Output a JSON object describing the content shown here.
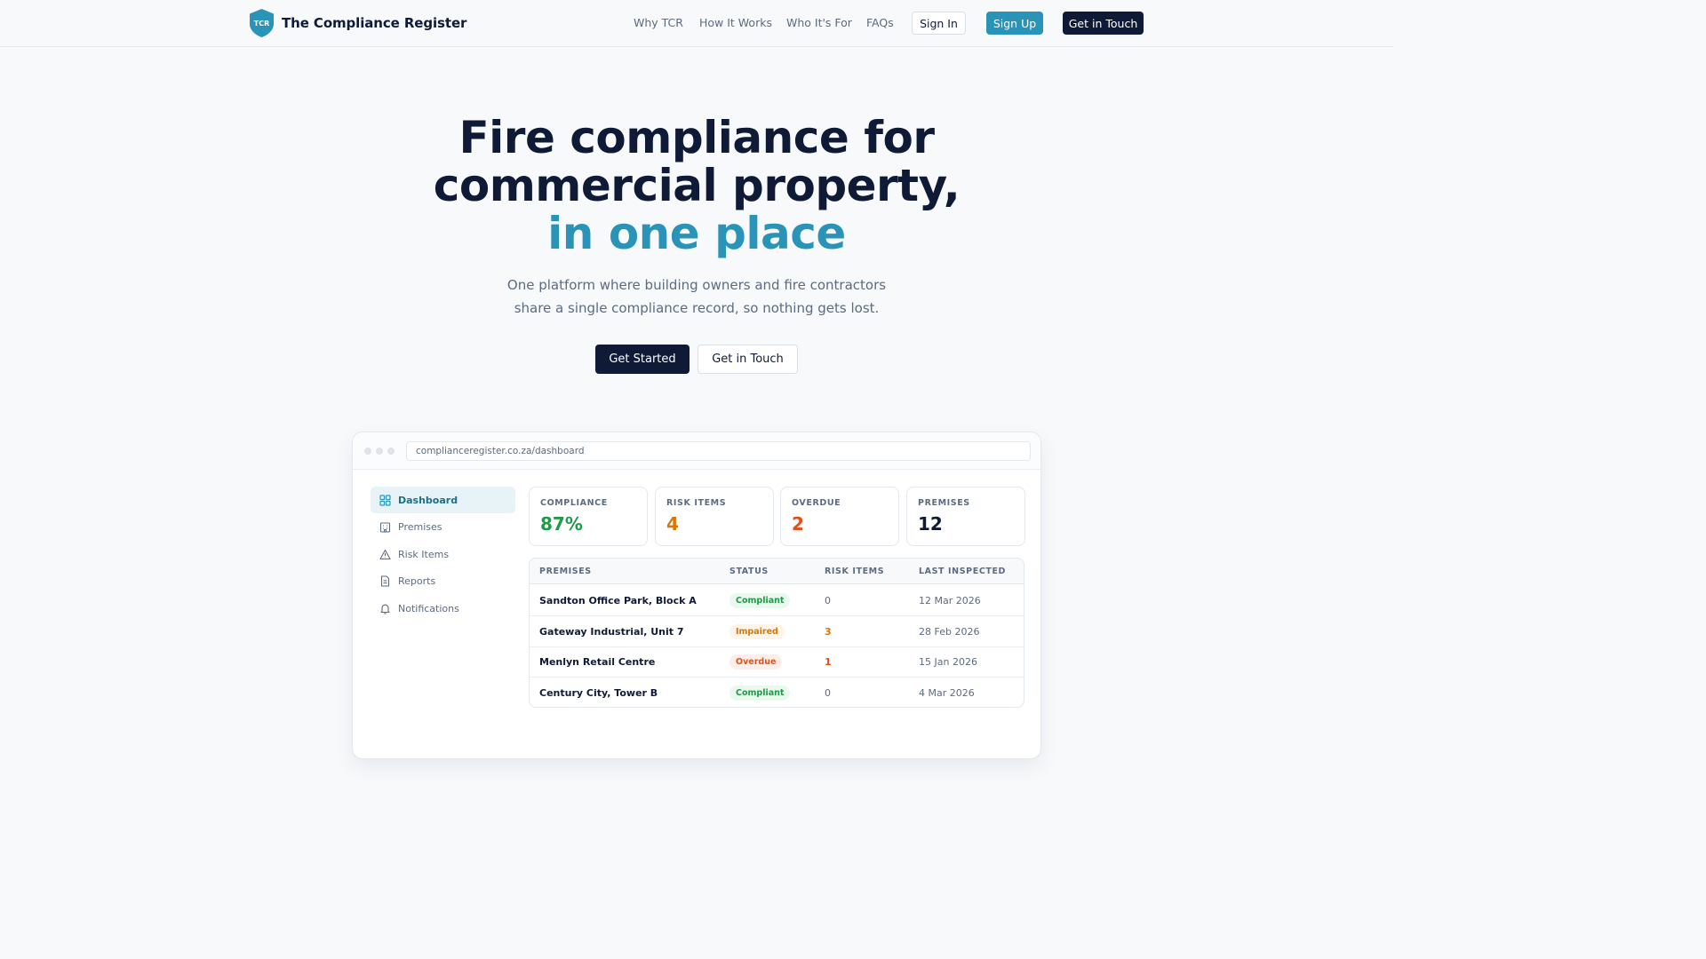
{
  "nav": {
    "brand_badge": "TCR",
    "brand_name": "The Compliance Register",
    "links": [
      "Why TCR",
      "How It Works",
      "Who It's For",
      "FAQs"
    ],
    "sign_in": "Sign In",
    "sign_up": "Sign Up",
    "get_in_touch": "Get in Touch"
  },
  "hero": {
    "title_line1": "Fire compliance for",
    "title_line2": "commercial property,",
    "title_accent": "in one place",
    "subtitle_line1": "One platform where building owners and fire contractors",
    "subtitle_line2": "share a single compliance record, so nothing gets lost.",
    "primary_cta": "Get Started",
    "secondary_cta": "Get in Touch"
  },
  "preview": {
    "url": "complianceregister.co.za/dashboard",
    "sidebar": [
      {
        "label": "Dashboard",
        "icon": "grid-icon",
        "active": true
      },
      {
        "label": "Premises",
        "icon": "building-icon",
        "active": false
      },
      {
        "label": "Risk Items",
        "icon": "warning-icon",
        "active": false
      },
      {
        "label": "Reports",
        "icon": "document-icon",
        "active": false
      },
      {
        "label": "Notifications",
        "icon": "bell-icon",
        "active": false
      }
    ],
    "stats": [
      {
        "label": "COMPLIANCE",
        "value": "87%",
        "color": "#1f9a49"
      },
      {
        "label": "RISK ITEMS",
        "value": "4",
        "color": "#d97706"
      },
      {
        "label": "OVERDUE",
        "value": "2",
        "color": "#e2501a"
      },
      {
        "label": "PREMISES",
        "value": "12",
        "color": "#0f1b36"
      }
    ],
    "table": {
      "headers": [
        "PREMISES",
        "STATUS",
        "RISK ITEMS",
        "LAST INSPECTED"
      ],
      "rows": [
        {
          "premises": "Sandton Office Park, Block A",
          "status": "Compliant",
          "risk_items": "0",
          "last_inspected": "12 Mar 2026"
        },
        {
          "premises": "Gateway Industrial, Unit 7",
          "status": "Impaired",
          "risk_items": "3",
          "last_inspected": "28 Feb 2026"
        },
        {
          "premises": "Menlyn Retail Centre",
          "status": "Overdue",
          "risk_items": "1",
          "last_inspected": "15 Jan 2026"
        },
        {
          "premises": "Century City, Tower B",
          "status": "Compliant",
          "risk_items": "0",
          "last_inspected": "4 Mar 2026"
        }
      ]
    }
  },
  "colors": {
    "navy": "#0f1b36",
    "accent": "#2a93b8",
    "compliant": "#1f9a49",
    "impaired": "#d97706",
    "overdue": "#e2501a"
  }
}
